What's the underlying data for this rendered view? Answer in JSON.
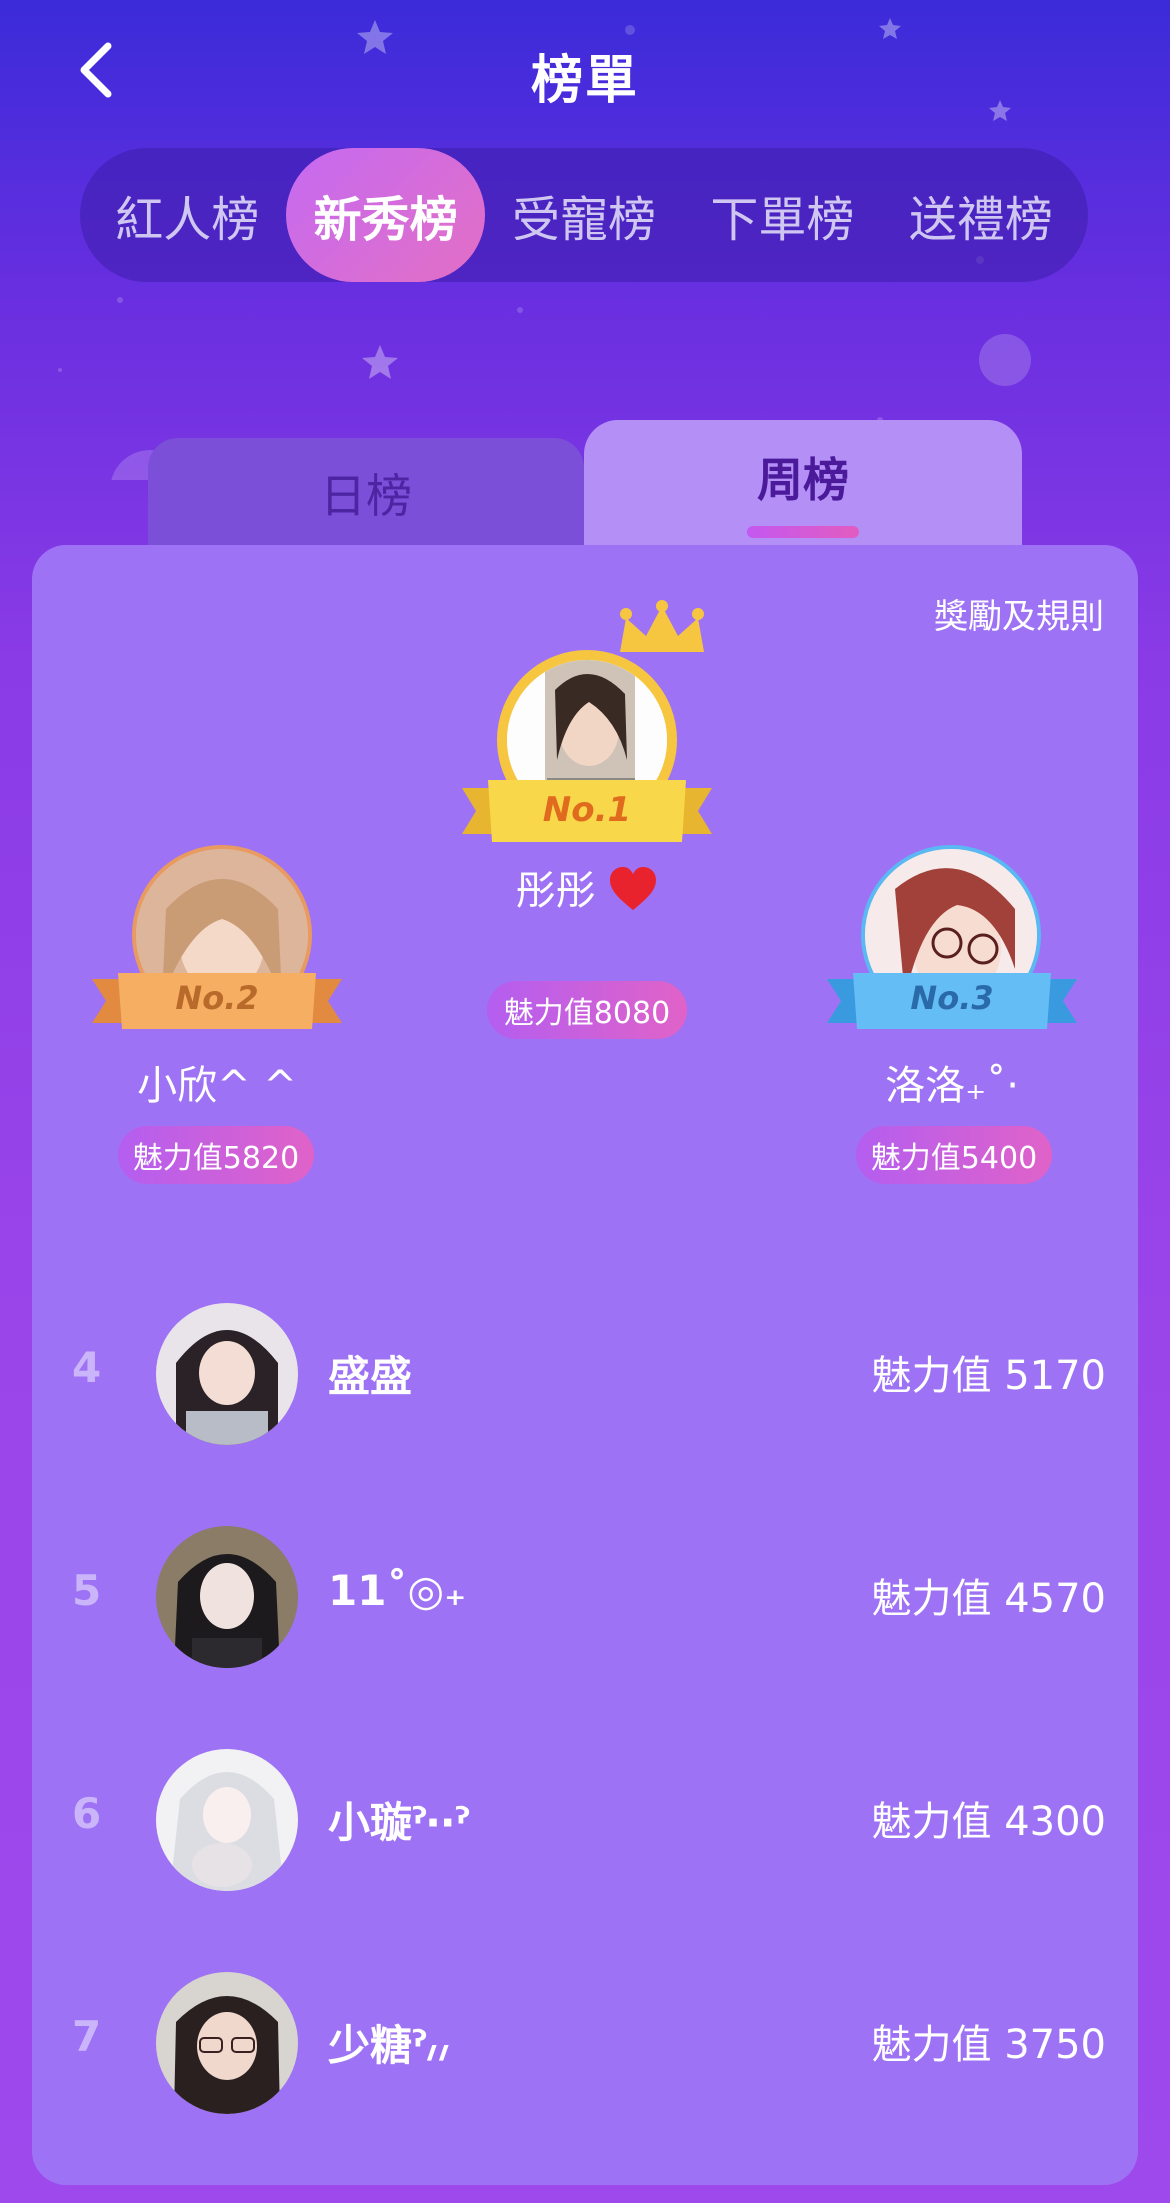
{
  "header": {
    "title": "榜單"
  },
  "categories": [
    {
      "label": "紅人榜",
      "active": false
    },
    {
      "label": "新秀榜",
      "active": true
    },
    {
      "label": "受寵榜",
      "active": false
    },
    {
      "label": "下單榜",
      "active": false
    },
    {
      "label": "送禮榜",
      "active": false
    }
  ],
  "periods": {
    "day": "日榜",
    "week": "周榜",
    "active": "week"
  },
  "rules_link": "獎勵及規則",
  "podium": {
    "first": {
      "badge": "No.1",
      "name": "彤彤",
      "charm": "魅力值8080"
    },
    "second": {
      "badge": "No.2",
      "name": "小欣^ ^",
      "charm": "魅力值5820"
    },
    "third": {
      "badge": "No.3",
      "name": "洛洛₊˚·",
      "charm": "魅力值5400"
    }
  },
  "list": [
    {
      "rank": "4",
      "name": "盛盛",
      "charm": "魅力值 5170"
    },
    {
      "rank": "5",
      "name": "11˚◎₊",
      "charm": "魅力值 4570"
    },
    {
      "rank": "6",
      "name": "小璇ˀ‧‧ˀ",
      "charm": "魅力值 4300"
    },
    {
      "rank": "7",
      "name": "少糖ˀ៸៸",
      "charm": "魅力值 3750"
    }
  ],
  "colors": {
    "accent": "#c56af2",
    "panel": "#9e72f4",
    "gold": "#f6c640",
    "silver_orange": "#f0a050",
    "bronze_blue": "#5ab8f2"
  },
  "icons": {
    "back": "chevron-left-icon",
    "crown": "crown-icon",
    "heart": "heart-icon"
  }
}
